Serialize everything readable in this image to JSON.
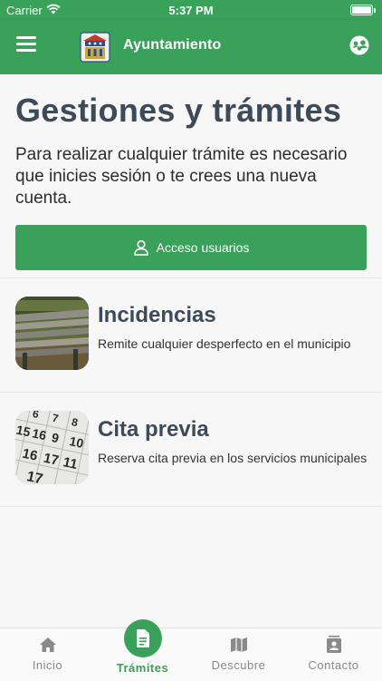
{
  "status_bar": {
    "carrier": "Carrier",
    "time": "5:37 PM"
  },
  "app_bar": {
    "title": "Ayuntamiento",
    "menu_icon": "hamburger-icon",
    "profile_icon": "user-group-icon"
  },
  "colors": {
    "primary": "#3aa15b",
    "heading": "#3d4a5a",
    "background": "#f7f7f7"
  },
  "page": {
    "title": "Gestiones y trámites",
    "intro": "Para realizar cualquier trámite es necesario que inicies sesión o te crees una nueva cuenta.",
    "access_button": "Acceso usuarios"
  },
  "cards": [
    {
      "title": "Incidencias",
      "description": "Remite cualquier desperfecto en el municipio",
      "image": "park-bench-photo"
    },
    {
      "title": "Cita previa",
      "description": "Reserva cita previa en los servicios municipales",
      "image": "calendar-photo"
    }
  ],
  "tabs": [
    {
      "label": "Inicio",
      "icon": "home-icon"
    },
    {
      "label": "Trámites",
      "icon": "document-icon",
      "active": true
    },
    {
      "label": "Descubre",
      "icon": "map-icon"
    },
    {
      "label": "Contacto",
      "icon": "contacts-icon"
    }
  ]
}
